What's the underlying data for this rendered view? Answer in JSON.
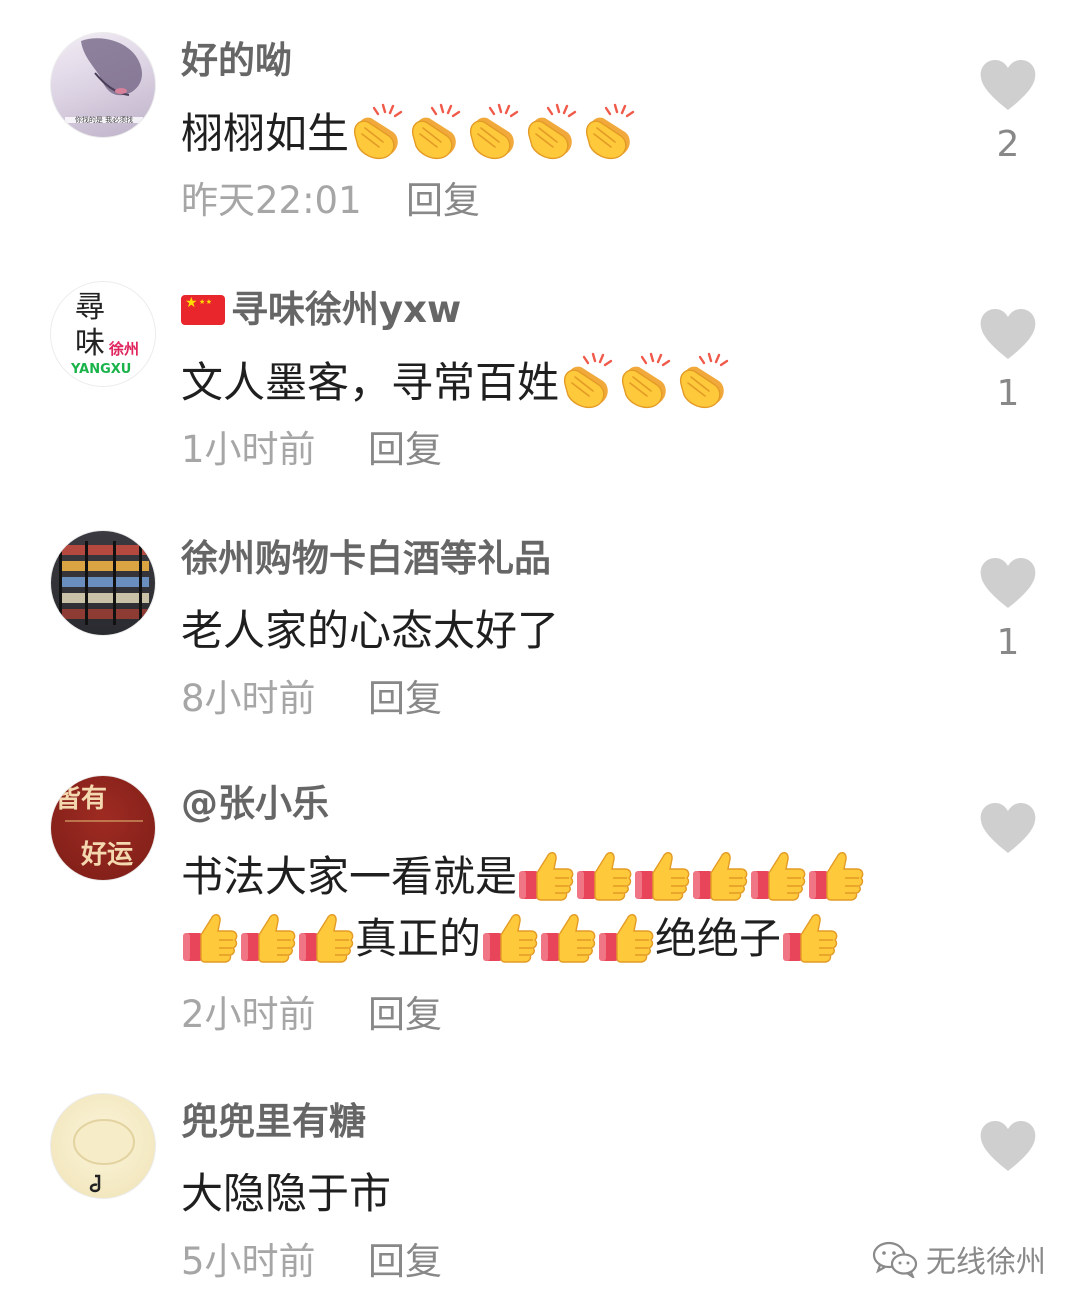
{
  "comments": [
    {
      "username": "好的呦",
      "text": "栩栩如生",
      "time": "昨天22:01",
      "reply": "回复",
      "likes": "2",
      "avatar_caption": "你找的是 我必须找"
    },
    {
      "username": "寻味徐州yxw",
      "text": "文人墨客，寻常百姓",
      "time": "1小时前",
      "reply": "回复",
      "likes": "1",
      "avatar_lines": [
        "尋",
        "味",
        "徐州",
        "YANGXU"
      ]
    },
    {
      "username": "徐州购物卡白酒等礼品",
      "text": "老人家的心态太好了",
      "time": "8小时前",
      "reply": "回复",
      "likes": "1"
    },
    {
      "username": "@张小乐",
      "text_line1": "书法大家一看就是",
      "text_line2_a": "真正的",
      "text_line2_b": "绝绝子",
      "time": "2小时前",
      "reply": "回复",
      "avatar_lines": [
        "皆有",
        "好运"
      ]
    },
    {
      "username": "兜兜里有糖",
      "text": "大隐隐于市",
      "time": "5小时前",
      "reply": "回复"
    }
  ],
  "watermark": {
    "text": "无线徐州",
    "icon": "wechat-icon"
  },
  "icons": {
    "like": "heart-icon",
    "clap": "clapping-hands-icon",
    "thumb": "thumbs-up-icon",
    "flag": "china-flag-icon"
  },
  "colors": {
    "username": "#666666",
    "text": "#1f1f1f",
    "meta": "#a6a6a6",
    "heart": "#cfcfcf",
    "emoji_yellow": "#ffc93c",
    "sleeve_red": "#e8455a"
  }
}
